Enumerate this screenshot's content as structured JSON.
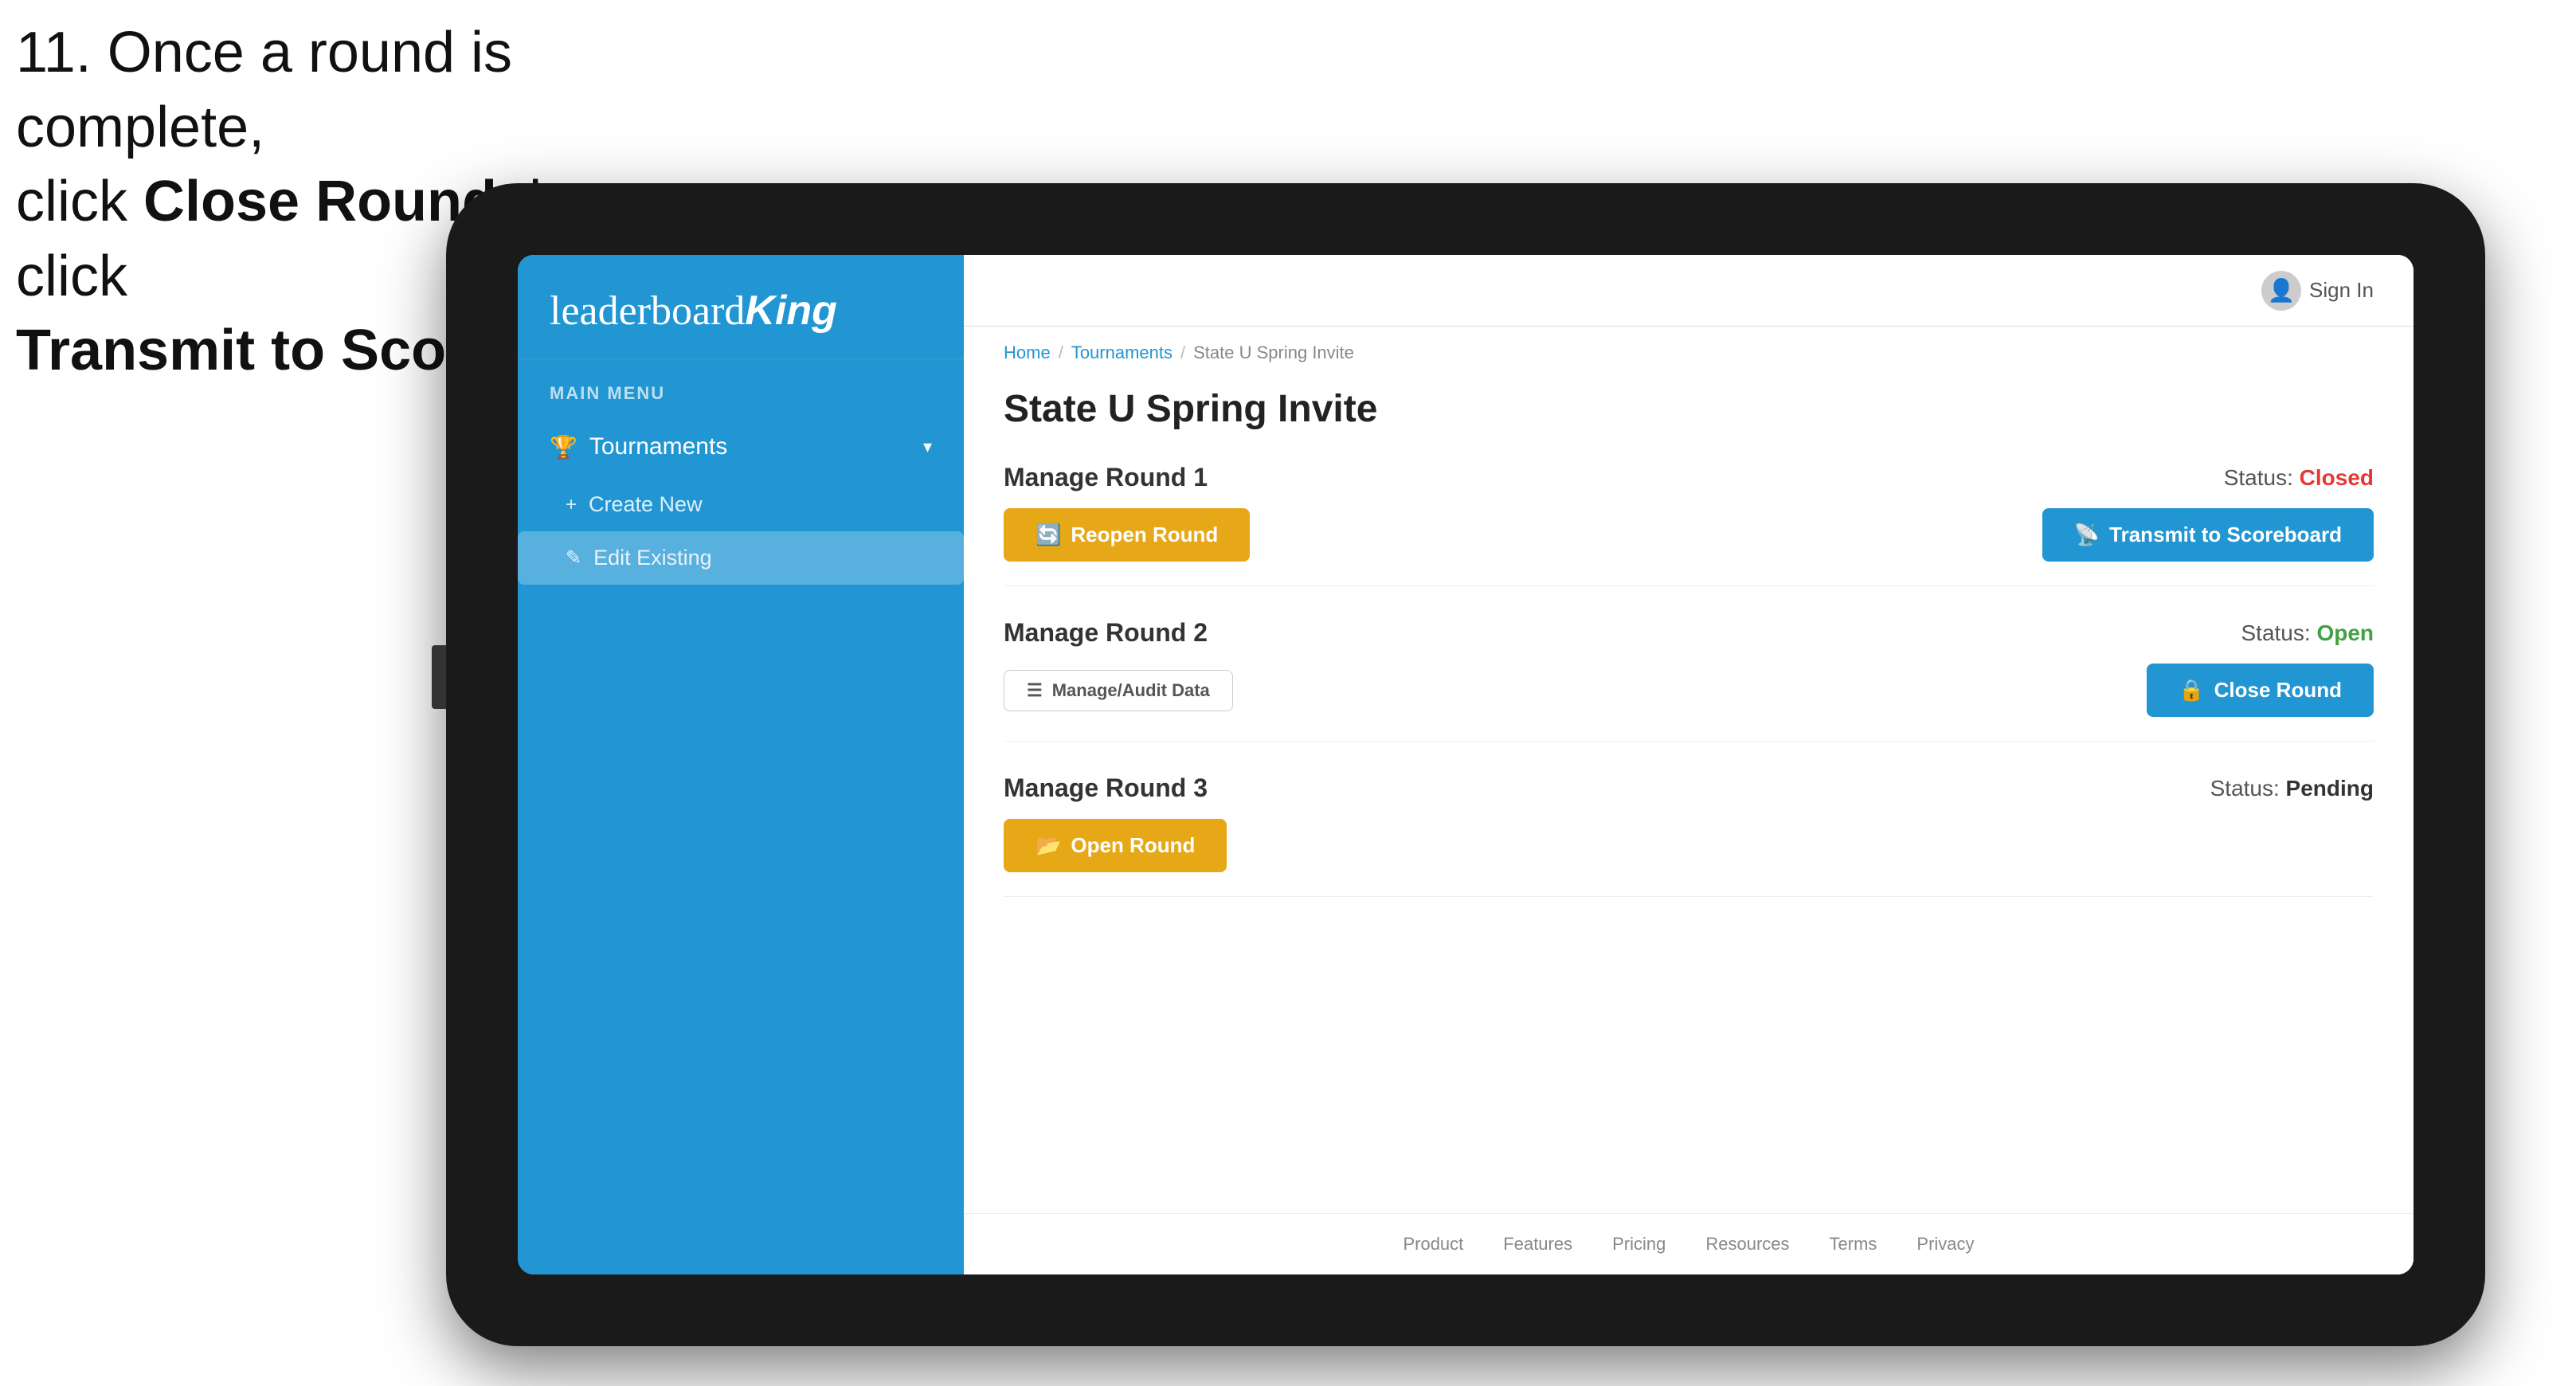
{
  "instruction": {
    "line1": "11. Once a round is complete,",
    "line2": "click ",
    "bold1": "Close Round",
    "line3": " then click",
    "bold2": "Transmit to Scoreboard."
  },
  "app": {
    "logo": {
      "prefix": "leaderboard",
      "suffix": "King"
    },
    "sidebar": {
      "menu_label": "MAIN MENU",
      "items": [
        {
          "label": "Tournaments",
          "icon": "🏆",
          "expanded": true,
          "sub_items": [
            {
              "label": "Create New",
              "icon": "+",
              "active": false
            },
            {
              "label": "Edit Existing",
              "icon": "✎",
              "active": true
            }
          ]
        }
      ]
    },
    "header": {
      "sign_in": "Sign In"
    },
    "breadcrumb": {
      "home": "Home",
      "tournaments": "Tournaments",
      "current": "State U Spring Invite"
    },
    "page": {
      "title": "State U Spring Invite",
      "rounds": [
        {
          "id": "round1",
          "title": "Manage Round 1",
          "status_label": "Status:",
          "status_value": "Closed",
          "status_class": "status-closed",
          "left_button": {
            "label": "Reopen Round",
            "icon": "🔄",
            "style": "gold"
          },
          "right_button": {
            "label": "Transmit to Scoreboard",
            "icon": "📡",
            "style": "blue"
          }
        },
        {
          "id": "round2",
          "title": "Manage Round 2",
          "status_label": "Status:",
          "status_value": "Open",
          "status_class": "status-open",
          "left_button": {
            "label": "Manage/Audit Data",
            "icon": "☰",
            "style": "outline"
          },
          "right_button": {
            "label": "Close Round",
            "icon": "🔒",
            "style": "blue"
          }
        },
        {
          "id": "round3",
          "title": "Manage Round 3",
          "status_label": "Status:",
          "status_value": "Pending",
          "status_class": "status-pending",
          "left_button": {
            "label": "Open Round",
            "icon": "📂",
            "style": "gold"
          },
          "right_button": null
        }
      ]
    },
    "footer": {
      "links": [
        "Product",
        "Features",
        "Pricing",
        "Resources",
        "Terms",
        "Privacy"
      ]
    }
  }
}
